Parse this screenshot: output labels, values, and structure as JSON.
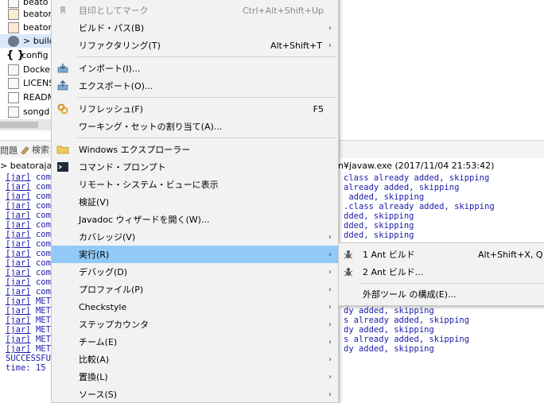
{
  "explorer": {
    "items": [
      {
        "label": "beato"
      },
      {
        "label": "beator"
      },
      {
        "label": "beator"
      },
      {
        "label": "> build"
      },
      {
        "label": "config"
      },
      {
        "label": "Docke"
      },
      {
        "label": "LICENS"
      },
      {
        "label": "READM"
      },
      {
        "label": "songd"
      }
    ]
  },
  "tabs": {
    "problems": "問題",
    "search": "検索"
  },
  "console_header": {
    "left": "> beatoraja",
    "right": "n¥javaw.exe (2017/11/04 21:53:42)"
  },
  "console": {
    "jar_tag": "[jar]",
    "prefix_com": "com/",
    "prefix_meta": "META",
    "success": "SUCCESSFUL",
    "time": "time: 15 s",
    "right_lines": [
      "class already added, skipping",
      "already added, skipping",
      " added, skipping",
      ".class already added, skipping",
      "dded, skipping",
      "dded, skipping",
      "dded, skipping",
      "dy added, skipping",
      "s already added, skipping",
      "dy added, skipping",
      "s already added, skipping",
      "dy added, skipping"
    ]
  },
  "context_menu": {
    "bookmark": {
      "label": "目印としてマーク",
      "accel": "Ctrl+Alt+Shift+Up"
    },
    "build_path": {
      "label": "ビルド・パス(B)"
    },
    "refactor": {
      "label": "リファクタリング(T)",
      "accel": "Alt+Shift+T"
    },
    "import": {
      "label": "インポート(I)..."
    },
    "export": {
      "label": "エクスポート(O)..."
    },
    "refresh": {
      "label": "リフレッシュ(F)",
      "accel": "F5"
    },
    "working_set": {
      "label": "ワーキング・セットの割り当て(A)..."
    },
    "explorer": {
      "label": "Windows エクスプローラー"
    },
    "cmd": {
      "label": "コマンド・プロンプト"
    },
    "remote": {
      "label": "リモート・システム・ビューに表示"
    },
    "validate": {
      "label": "検証(V)"
    },
    "javadoc": {
      "label": "Javadoc ウィザードを開く(W)..."
    },
    "coverage": {
      "label": "カバレッジ(V)"
    },
    "run": {
      "label": "実行(R)"
    },
    "debug": {
      "label": "デバッグ(D)"
    },
    "profile": {
      "label": "プロファイル(P)"
    },
    "checkstyle": {
      "label": "Checkstyle"
    },
    "stepcounter": {
      "label": "ステップカウンタ"
    },
    "team": {
      "label": "チーム(E)"
    },
    "compare": {
      "label": "比較(A)"
    },
    "replace": {
      "label": "置換(L)"
    },
    "source": {
      "label": "ソース(S)"
    }
  },
  "submenu": {
    "ant1": {
      "label": "1 Ant ビルド",
      "accel": "Alt+Shift+X, Q"
    },
    "ant2": {
      "label": "2 Ant ビルド..."
    },
    "ext_tools": {
      "label": "外部ツール の構成(E)..."
    }
  },
  "colors": {
    "menu_bg": "#f2f2f2",
    "highlight": "#91c9f7",
    "console_text": "#1a1aaa"
  }
}
